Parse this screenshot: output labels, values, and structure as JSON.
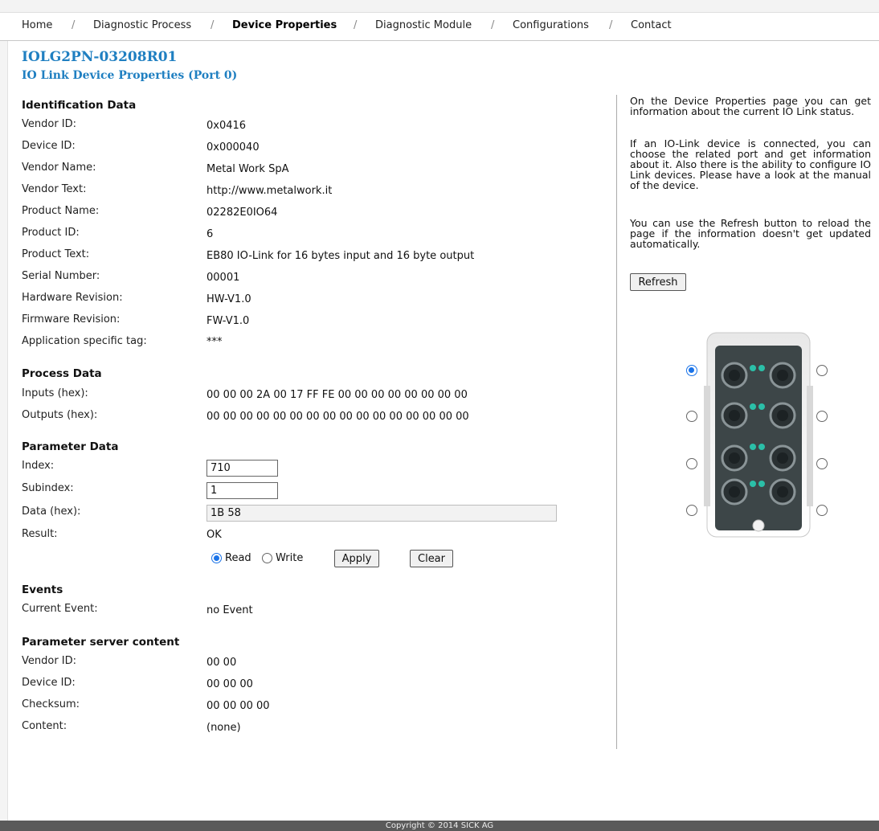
{
  "nav": {
    "items": [
      "Home",
      "Diagnostic Process",
      "Device Properties",
      "Diagnostic Module",
      "Configurations",
      "Contact"
    ],
    "separator": "/"
  },
  "page": {
    "device_name": "IOLG2PN-03208R01",
    "subtitle": "IO Link Device Properties (Port 0)"
  },
  "identification": {
    "heading": "Identification Data",
    "rows": [
      {
        "label": "Vendor ID:",
        "value": "0x0416"
      },
      {
        "label": "Device ID:",
        "value": "0x000040"
      },
      {
        "label": "Vendor Name:",
        "value": "Metal Work SpA"
      },
      {
        "label": "Vendor Text:",
        "value": "http://www.metalwork.it"
      },
      {
        "label": "Product Name:",
        "value": "02282E0IO64"
      },
      {
        "label": "Product ID:",
        "value": "6"
      },
      {
        "label": "Product Text:",
        "value": "EB80 IO-Link for 16 bytes input and 16 byte output"
      },
      {
        "label": "Serial Number:",
        "value": "00001"
      },
      {
        "label": "Hardware Revision:",
        "value": "HW-V1.0"
      },
      {
        "label": "Firmware Revision:",
        "value": "FW-V1.0"
      },
      {
        "label": "Application specific tag:",
        "value": "***"
      }
    ]
  },
  "process": {
    "heading": "Process Data",
    "inputs_label": "Inputs (hex):",
    "inputs_value": "00 00 00 2A 00 17 FF FE 00 00 00 00 00 00 00 00",
    "outputs_label": "Outputs (hex):",
    "outputs_value": "00 00 00 00 00 00 00 00 00 00 00 00 00 00 00 00"
  },
  "parameter": {
    "heading": "Parameter Data",
    "index_label": "Index:",
    "index_value": "710",
    "subindex_label": "Subindex:",
    "subindex_value": "1",
    "data_label": "Data (hex):",
    "data_value": "1B 58",
    "result_label": "Result:",
    "result_value": "OK",
    "read_label": "Read",
    "write_label": "Write",
    "mode_selected": "Read",
    "apply_label": "Apply",
    "clear_label": "Clear"
  },
  "events": {
    "heading": "Events",
    "current_label": "Current Event:",
    "current_value": "no Event"
  },
  "param_server": {
    "heading": "Parameter server content",
    "rows": [
      {
        "label": "Vendor ID:",
        "value": "00 00"
      },
      {
        "label": "Device ID:",
        "value": "00 00 00"
      },
      {
        "label": "Checksum:",
        "value": "00 00 00 00"
      },
      {
        "label": "Content:",
        "value": "(none)"
      }
    ]
  },
  "help": {
    "paragraph1": "On the Device Properties page you can get information about the current IO Link status.",
    "paragraph2": "If an IO-Link device is connected, you can choose the related port and get information about it. Also there is the ability to configure IO Link devices. Please have a look at the manual of the device.",
    "paragraph3": "You can use the Refresh button to reload the page if the information doesn't get updated automatically.",
    "refresh_label": "Refresh"
  },
  "ports": {
    "selected_port": 0,
    "count": 8
  },
  "colors": {
    "title_blue": "#1f7fc1",
    "radio_blue": "#1a73e8",
    "footer_bg": "#5a5a5a",
    "led_teal": "#2bbfa8"
  },
  "footer": {
    "copyright": "Copyright © 2014 SICK AG"
  }
}
